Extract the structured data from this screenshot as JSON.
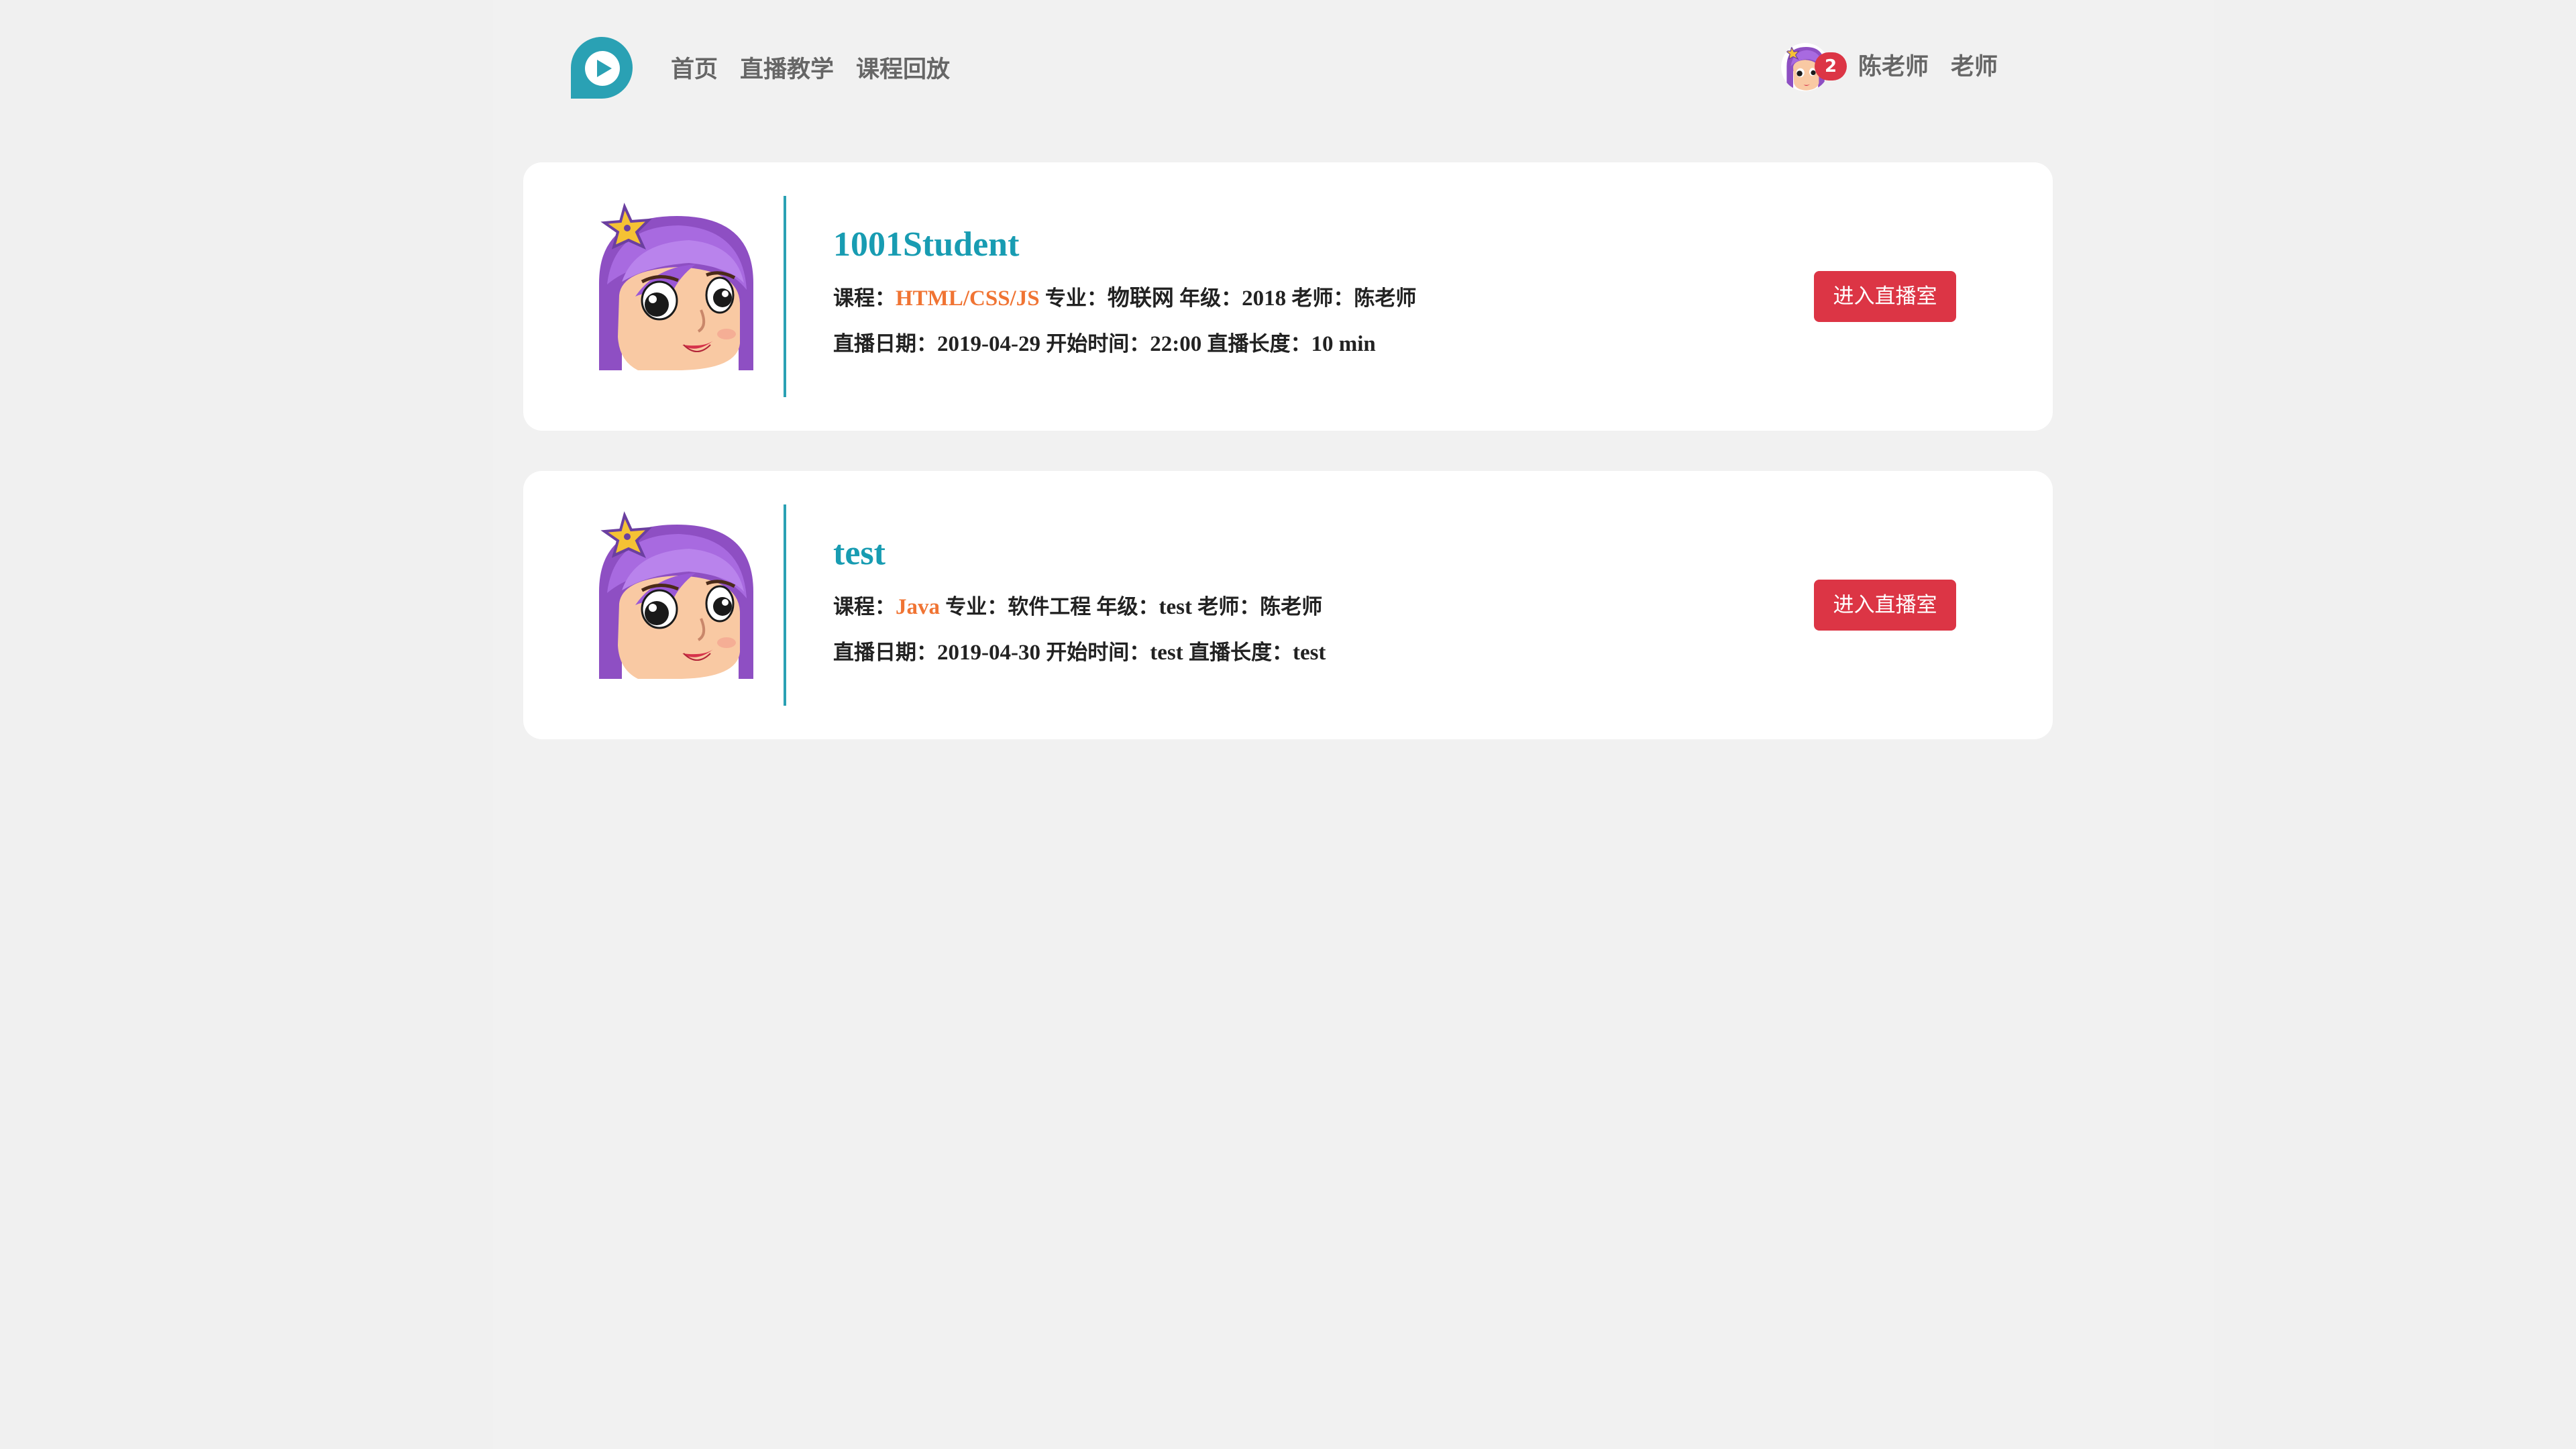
{
  "header": {
    "nav": [
      {
        "label": "首页"
      },
      {
        "label": "直播教学"
      },
      {
        "label": "课程回放"
      }
    ],
    "user": {
      "notification_count": "2",
      "name": "陈老师",
      "role": "老师"
    }
  },
  "colors": {
    "accent": "#189cb2",
    "button": "#dc3545",
    "course_highlight": "#f07433",
    "background": "#f0f0f0"
  },
  "icons": {
    "logo": "play-icon",
    "avatar": "cartoon-girl-avatar"
  },
  "labels": {
    "course": "课程：",
    "major": "专业：",
    "grade": "年级：",
    "teacher": "老师：",
    "date": "直播日期：",
    "start": "开始时间：",
    "length": "直播长度："
  },
  "lessons": [
    {
      "title": "1001Student",
      "course": "HTML/CSS/JS",
      "major": "物联网",
      "grade": "2018",
      "teacher": "陈老师",
      "date": "2019-04-29",
      "start": "22:00",
      "length": "10 min",
      "button": "进入直播室"
    },
    {
      "title": "test",
      "course": "Java",
      "major": "软件工程",
      "grade": "test",
      "teacher": "陈老师",
      "date": "2019-04-30",
      "start": "test",
      "length": "test",
      "button": "进入直播室"
    }
  ]
}
